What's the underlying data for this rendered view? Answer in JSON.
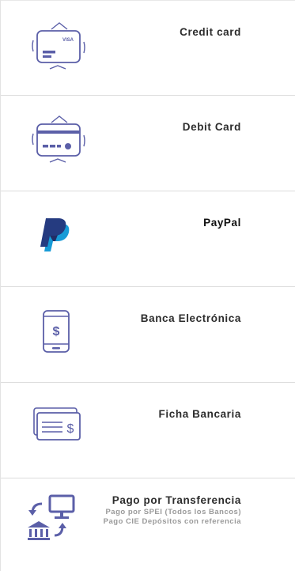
{
  "colors": {
    "icon_stroke": "#5b5fa8",
    "paypal_dark": "#253b80",
    "paypal_light": "#179bd7",
    "divider": "#dcdcdc",
    "subtext": "#9a9a9a"
  },
  "payment_options": [
    {
      "label": "Credit card",
      "icon": "credit-card-icon",
      "card_brand": "VISA"
    },
    {
      "label": "Debit Card",
      "icon": "debit-card-icon"
    },
    {
      "label": "PayPal",
      "icon": "paypal-logo"
    },
    {
      "label": "Banca Electrónica",
      "icon": "mobile-dollar-icon"
    },
    {
      "label": "Ficha Bancaria",
      "icon": "bank-check-icon",
      "symbol": "$"
    },
    {
      "label": "Pago por Transferencia",
      "icon": "bank-transfer-icon",
      "details": [
        "Pago por SPEI (Todos los Bancos)",
        "Pago CIE Depósitos con referencia"
      ]
    }
  ]
}
